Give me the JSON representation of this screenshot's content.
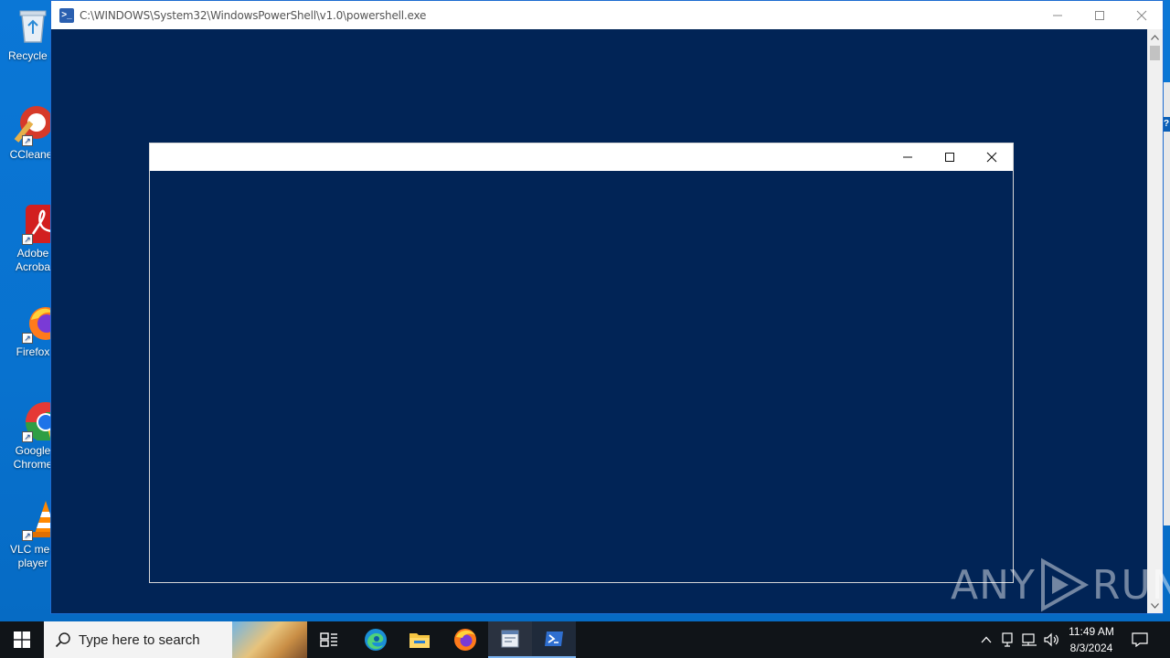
{
  "desktop": {
    "icons": [
      {
        "label": "Recycle B",
        "icon": "recycle-bin-icon"
      },
      {
        "label": "CCleaner",
        "icon": "ccleaner-icon"
      },
      {
        "label": "Adobe\nAcroba",
        "icon": "adobe-acrobat-icon"
      },
      {
        "label": "Firefox",
        "icon": "firefox-icon"
      },
      {
        "label": "Google\nChrome",
        "icon": "chrome-icon"
      },
      {
        "label": "VLC med\nplayer",
        "icon": "vlc-icon"
      }
    ]
  },
  "powershell_window": {
    "title": "C:\\WINDOWS\\System32\\WindowsPowerShell\\v1.0\\powershell.exe",
    "background": "#012456"
  },
  "inner_window": {
    "title": ""
  },
  "watermark": {
    "left": "ANY",
    "right": "RUN"
  },
  "taskbar": {
    "search_placeholder": "Type here to search",
    "apps": [
      "task-view",
      "edge",
      "file-explorer",
      "firefox",
      "unknown-app",
      "powershell"
    ],
    "time": "11:49 AM",
    "date": "8/3/2024"
  },
  "colors": {
    "desktop": "#0872cf",
    "console": "#012456",
    "taskbar": "#101418"
  }
}
